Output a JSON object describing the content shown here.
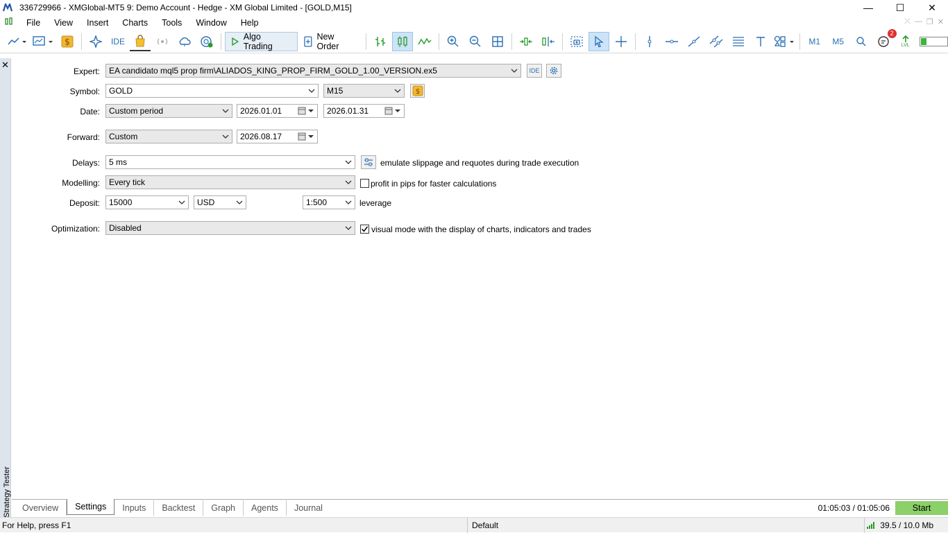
{
  "window": {
    "title": "336729966 - XMGlobal-MT5 9: Demo Account - Hedge - XM Global Limited - [GOLD,M15]",
    "minimize": "—",
    "maximize": "☐",
    "close": "✕"
  },
  "menu": [
    "File",
    "View",
    "Insert",
    "Charts",
    "Tools",
    "Window",
    "Help"
  ],
  "toolbar": {
    "ide_label": "IDE",
    "algo_trading_label": "Algo Trading",
    "new_order_label": "New Order",
    "tf_m1": "M1",
    "tf_m5": "M5",
    "notifications_count": "2",
    "signal_label": "LVL"
  },
  "side": {
    "label": "Strategy Tester",
    "close": "✕"
  },
  "form": {
    "expert_label": "Expert:",
    "expert_value": "EA candidato mql5 prop firm\\ALIADOS_KING_PROP_FIRM_GOLD_1.00_VERSION.ex5",
    "expert_ide": "IDE",
    "symbol_label": "Symbol:",
    "symbol_value": "GOLD",
    "timeframe_value": "M15",
    "date_label": "Date:",
    "date_mode": "Custom period",
    "date_from": "2026.01.01",
    "date_to": "2026.01.31",
    "forward_label": "Forward:",
    "forward_mode": "Custom",
    "forward_date": "2026.08.17",
    "delays_label": "Delays:",
    "delays_value": "5 ms",
    "delays_note": "emulate slippage and requotes during trade execution",
    "modelling_label": "Modelling:",
    "modelling_value": "Every tick",
    "pips_label": "profit in pips for faster calculations",
    "pips_checked": false,
    "deposit_label": "Deposit:",
    "deposit_value": "15000",
    "currency_value": "USD",
    "leverage_value": "1:500",
    "leverage_label": "leverage",
    "optimization_label": "Optimization:",
    "optimization_value": "Disabled",
    "visual_label": "visual mode with the display of charts, indicators and trades",
    "visual_checked": true
  },
  "tabs": [
    "Overview",
    "Settings",
    "Inputs",
    "Backtest",
    "Graph",
    "Agents",
    "Journal"
  ],
  "active_tab": "Settings",
  "tester": {
    "timer": "01:05:03 / 01:05:06",
    "start_label": "Start"
  },
  "status": {
    "help": "For Help, press F1",
    "profile": "Default",
    "memory": "39.5 / 10.0 Mb"
  },
  "colors": {
    "start_button": "#8bd068",
    "accent": "#2a6fb4",
    "badge": "#e03030"
  }
}
